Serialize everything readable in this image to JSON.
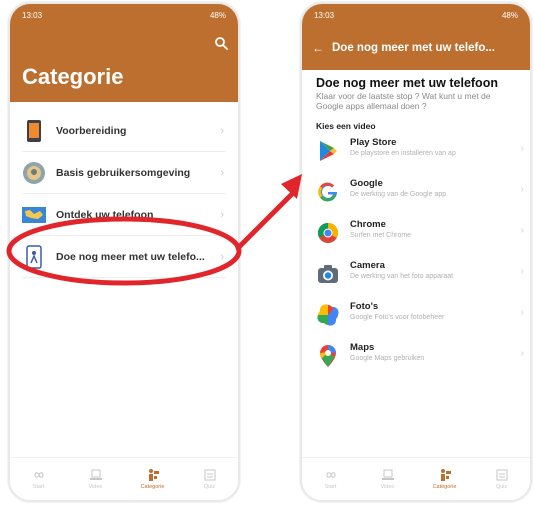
{
  "left": {
    "status_time": "13:03",
    "status_right": "48%",
    "title": "Categorie",
    "categories": [
      {
        "label": "Voorbereiding",
        "icon": "phone-icon"
      },
      {
        "label": "Basis gebruikersomgeving",
        "icon": "badge-icon"
      },
      {
        "label": "Ontdek uw telefoon",
        "icon": "map-icon"
      },
      {
        "label": "Doe nog meer met uw telefo...",
        "icon": "phone-person-icon"
      }
    ],
    "nav": [
      {
        "label": "Start",
        "icon": "infinity-icon"
      },
      {
        "label": "Video",
        "icon": "laptop-icon"
      },
      {
        "label": "Categorie",
        "icon": "category-icon",
        "active": true
      },
      {
        "label": "Quiz",
        "icon": "quiz-icon"
      }
    ]
  },
  "right": {
    "status_time": "13:03",
    "status_right": "48%",
    "header_title": "Doe nog meer met uw telefo...",
    "intro_title": "Doe nog meer met uw telefoon",
    "intro_sub": "Klaar voor de laatste stop ? Wat kunt u met de Google apps allemaal doen ?",
    "kies": "Kies een video",
    "videos": [
      {
        "title": "Play Store",
        "sub": "De playstore en installeren van ap"
      },
      {
        "title": "Google",
        "sub": "De werking van de Google app"
      },
      {
        "title": "Chrome",
        "sub": "Surfen met Chrome"
      },
      {
        "title": "Camera",
        "sub": "De werking van het foto apparaat"
      },
      {
        "title": "Foto's",
        "sub": "Google Foto's voor fotobeheer"
      },
      {
        "title": "Maps",
        "sub": "Google Maps gebruiken"
      }
    ],
    "nav": [
      {
        "label": "Start",
        "icon": "infinity-icon"
      },
      {
        "label": "Video",
        "icon": "laptop-icon"
      },
      {
        "label": "Categorie",
        "icon": "category-icon",
        "active": true
      },
      {
        "label": "Quiz",
        "icon": "quiz-icon"
      }
    ]
  },
  "colors": {
    "brand": "#bd6f2f",
    "annotation": "#e0262b"
  }
}
